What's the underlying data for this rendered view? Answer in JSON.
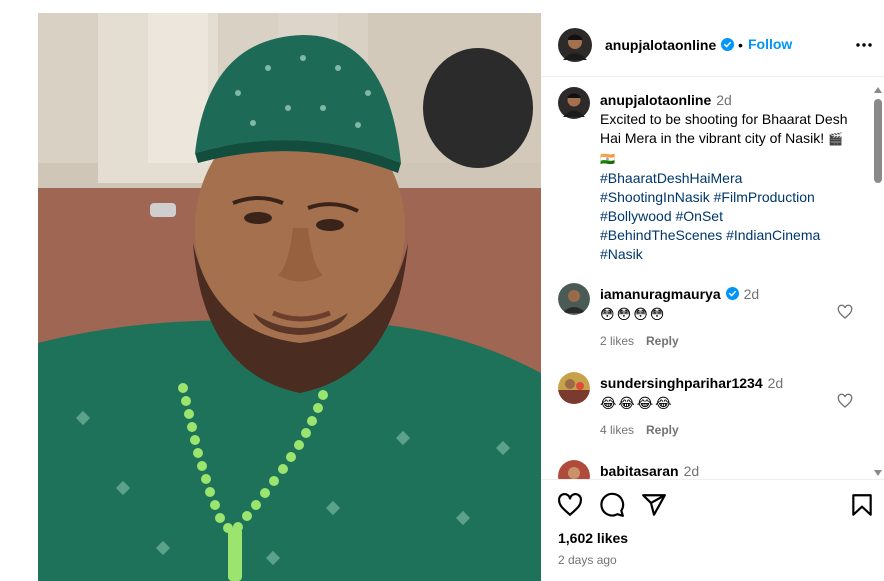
{
  "post": {
    "author": "anupjalotaonline",
    "follow_label": "Follow",
    "dot": "•"
  },
  "caption": {
    "username": "anupjalotaonline",
    "time": "2d",
    "text": "Excited to be shooting for Bhaarat Desh Hai Mera in the vibrant city of Nasik!",
    "emoji": "🎬🇮🇳",
    "hashtags": [
      "#BhaaratDeshHaiMera",
      "#ShootingInNasik",
      "#FilmProduction",
      "#Bollywood",
      "#OnSet",
      "#BehindTheScenes",
      "#IndianCinema",
      "#Nasik"
    ]
  },
  "comments": [
    {
      "username": "iamanuragmaurya",
      "verified": true,
      "time": "2d",
      "text": "😳😳😳😳",
      "likes": "2 likes",
      "reply": "Reply"
    },
    {
      "username": "sundersinghparihar1234",
      "verified": false,
      "time": "2d",
      "text": "😂😂😂😂",
      "likes": "4 likes",
      "reply": "Reply"
    },
    {
      "username": "babitasaran",
      "verified": false,
      "time": "2d"
    }
  ],
  "footer": {
    "likes": "1,602 likes",
    "posted": "2 days ago"
  },
  "colors": {
    "accent": "#0095f6",
    "verified": "#0095f6",
    "hashtag": "#00376b",
    "muted": "#737373"
  },
  "icons": {
    "like": "heart-icon",
    "comment": "comment-icon",
    "share": "share-icon",
    "save": "bookmark-icon",
    "more": "more-options-icon"
  }
}
